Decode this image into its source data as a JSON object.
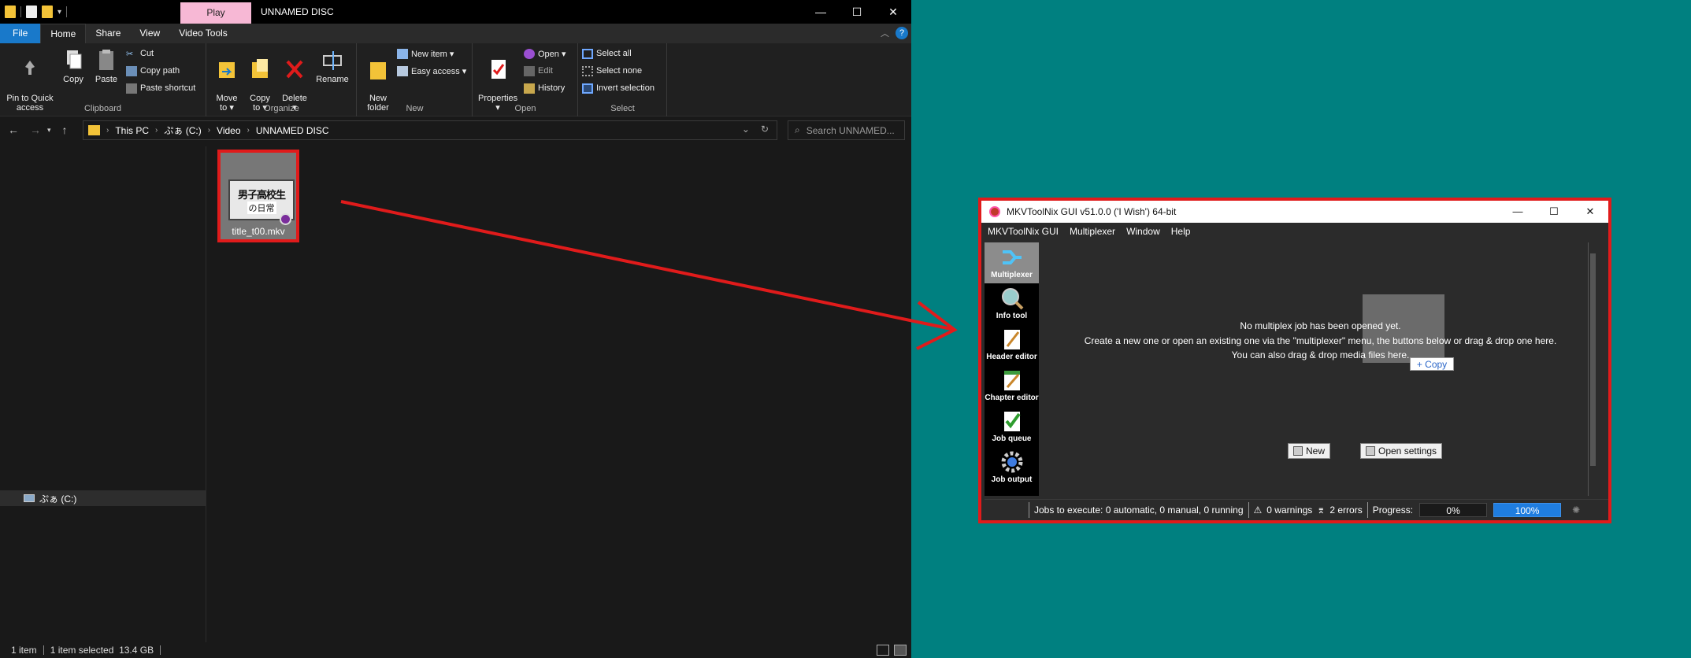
{
  "explorer": {
    "window_title": "UNNAMED DISC",
    "context_tab": "Play",
    "controls": {
      "minimize": "—",
      "maximize": "☐",
      "close": "✕"
    },
    "ribbon_tabs": [
      "File",
      "Home",
      "Share",
      "View",
      "Video Tools"
    ],
    "ribbon": {
      "clipboard": {
        "label": "Clipboard",
        "pin": "Pin to Quick\naccess",
        "copy": "Copy",
        "paste": "Paste",
        "cut": "Cut",
        "copy_path": "Copy path",
        "paste_shortcut": "Paste shortcut"
      },
      "organize": {
        "label": "Organize",
        "move_to": "Move\nto ▾",
        "copy_to": "Copy\nto ▾",
        "delete": "Delete\n▾",
        "rename": "Rename"
      },
      "new": {
        "label": "New",
        "new_folder": "New\nfolder",
        "new_item": "New item ▾",
        "easy_access": "Easy access ▾"
      },
      "open": {
        "label": "Open",
        "properties": "Properties\n▾",
        "open": "Open ▾",
        "edit": "Edit",
        "history": "History"
      },
      "select": {
        "label": "Select",
        "select_all": "Select all",
        "select_none": "Select none",
        "invert_selection": "Invert selection"
      }
    },
    "address": {
      "path": [
        "This PC",
        "ぷぁ (C:)",
        "Video",
        "UNNAMED DISC"
      ],
      "search_placeholder": "Search UNNAMED..."
    },
    "nav_pane": {
      "drive": "ぷぁ (C:)"
    },
    "file": {
      "name": "title_t00.mkv",
      "thumb_text_1": "男子高校生",
      "thumb_text_2": "の日常"
    },
    "status": {
      "items": "1 item",
      "selected": "1 item selected  13.4 GB"
    }
  },
  "mkvtoolnix": {
    "title": "MKVToolNix GUI v51.0.0 ('I Wish') 64-bit",
    "menu": [
      "MKVToolNix GUI",
      "Multiplexer",
      "Window",
      "Help"
    ],
    "sidebar": [
      "Multiplexer",
      "Info tool",
      "Header editor",
      "Chapter editor",
      "Job queue",
      "Job output"
    ],
    "messages": {
      "line1": "No multiplex job has been opened yet.",
      "line2": "Create a new one or open an existing one via the \"multiplexer\" menu, the buttons below or drag & drop one here.",
      "line3": "You can also drag & drop media files here."
    },
    "drag_tooltip": "+ Copy",
    "buttons": {
      "new": "New",
      "open_settings": "Open settings"
    },
    "status": {
      "jobs": "Jobs to execute:  0 automatic, 0 manual, 0 running",
      "warnings": "0 warnings",
      "errors": "2 errors",
      "progress_label": "Progress:",
      "progress_current": "0%",
      "progress_total": "100%"
    }
  },
  "colors": {
    "highlight": "#e01b1b",
    "desktop": "#008080",
    "accent": "#1979ca"
  }
}
